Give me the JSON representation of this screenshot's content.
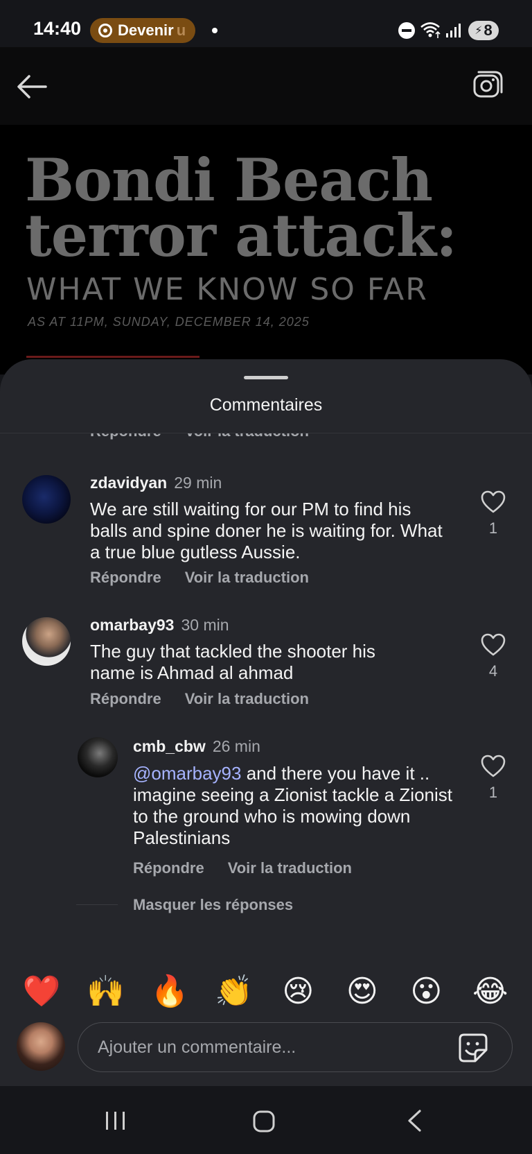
{
  "status_bar": {
    "time": "14:40",
    "pill_label": "Devenir",
    "pill_fade": "u",
    "battery": "8",
    "icons": [
      "dnd-icon",
      "wifi-icon",
      "signal-icon",
      "battery-icon"
    ]
  },
  "story": {
    "title_line1": "Bondi Beach",
    "title_line2": "terror attack:",
    "subtitle": "WHAT WE KNOW SO FAR",
    "date": "AS AT 11PM, SUNDAY, DECEMBER 14, 2025"
  },
  "sheet": {
    "title": "Commentaires",
    "ghost_reply": "Répondre",
    "ghost_translate": "Voir la traduction"
  },
  "comments": [
    {
      "username": "zdavidyan",
      "time": "29 min",
      "text": "We are still waiting for our PM to find his balls and spine doner he is waiting for. What a true blue gutless Aussie.",
      "reply": "Répondre",
      "translate": "Voir la traduction",
      "likes": "1"
    },
    {
      "username": "omarbay93",
      "time": "30 min",
      "text": "The guy that tackled the shooter his name is Ahmad al ahmad",
      "reply": "Répondre",
      "translate": "Voir la traduction",
      "likes": "4"
    },
    {
      "username": "cmb_cbw",
      "time": "26 min",
      "mention": "@omarbay93",
      "text": " and there you have it .. imagine seeing a Zionist tackle a Zionist to the ground who is mowing down Palestinians",
      "reply": "Répondre",
      "translate": "Voir la traduction",
      "likes": "1"
    }
  ],
  "hide_replies": "Masquer les réponses",
  "emoji_bar": [
    "❤️",
    "🙌",
    "🔥",
    "👏",
    "😢",
    "😍",
    "😮",
    "😂"
  ],
  "composer": {
    "placeholder": "Ajouter un commentaire..."
  },
  "colors": {
    "sheet_bg": "#25262b",
    "mention": "#a6b3ff",
    "pill": "#7a4c12"
  }
}
